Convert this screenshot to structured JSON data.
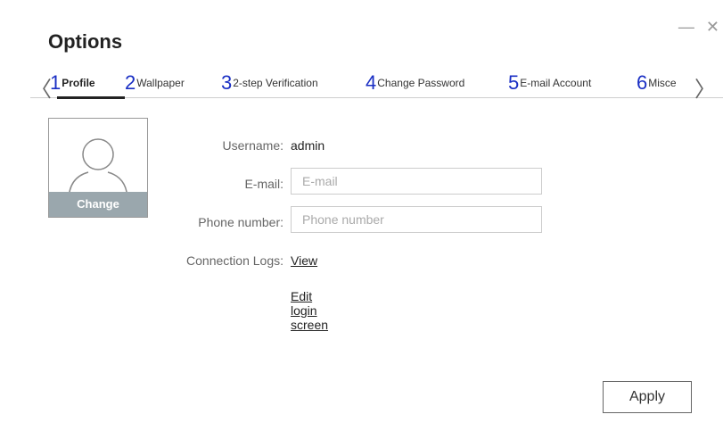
{
  "window": {
    "title": "Options",
    "minimize_label": "—",
    "close_label": "✕"
  },
  "tabs": [
    {
      "num": "1",
      "label": "Profile",
      "active": true
    },
    {
      "num": "2",
      "label": "Wallpaper",
      "active": false
    },
    {
      "num": "3",
      "label": "2-step Verification",
      "active": false
    },
    {
      "num": "4",
      "label": "Change Password",
      "active": false
    },
    {
      "num": "5",
      "label": "E-mail Account",
      "active": false
    },
    {
      "num": "6",
      "label": "Misce",
      "active": false
    }
  ],
  "nav": {
    "prev_icon": "chevron-left-icon",
    "next_icon": "chevron-right-icon",
    "prev_glyph": "〈",
    "next_glyph": "〉"
  },
  "profile": {
    "avatar_change_label": "Change",
    "username_label": "Username:",
    "username_value": "admin",
    "email_label": "E-mail:",
    "email_value": "",
    "email_placeholder": "E-mail",
    "phone_label": "Phone number:",
    "phone_value": "",
    "phone_placeholder": "Phone number",
    "connection_logs_label": "Connection Logs:",
    "connection_logs_link": "View",
    "edit_login_screen_link": "Edit login screen"
  },
  "footer": {
    "apply_label": "Apply"
  },
  "colors": {
    "tab_number": "#1a2fc4",
    "avatar_bar": "#9aa7ad"
  }
}
